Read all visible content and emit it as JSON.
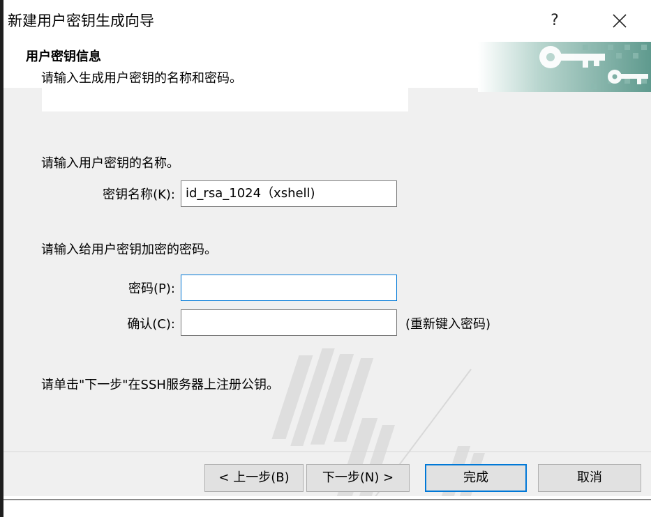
{
  "window": {
    "title": "新建用户密钥生成向导",
    "help_label": "?",
    "close_icon": "close-icon"
  },
  "header": {
    "title": "用户密钥信息",
    "description": "请输入生成用户密钥的名称和密码。",
    "art_icon": "key-icon"
  },
  "form": {
    "name_prompt": "请输入用户密钥的名称。",
    "name_label": "密钥名称(K):",
    "name_value": "id_rsa_1024（xshell)",
    "password_prompt": "请输入给用户密钥加密的密码。",
    "password_label": "密码(P):",
    "password_value": "",
    "confirm_label": "确认(C):",
    "confirm_value": "",
    "confirm_hint": "(重新键入密码)",
    "next_hint": "请单击\"下一步\"在SSH服务器上注册公钥。"
  },
  "buttons": {
    "back": "< 上一步(B)",
    "next": "下一步(N) >",
    "finish": "完成",
    "cancel": "取消"
  },
  "colors": {
    "dialog_bg": "#f0f0f0",
    "focus_border": "#0078d7"
  }
}
